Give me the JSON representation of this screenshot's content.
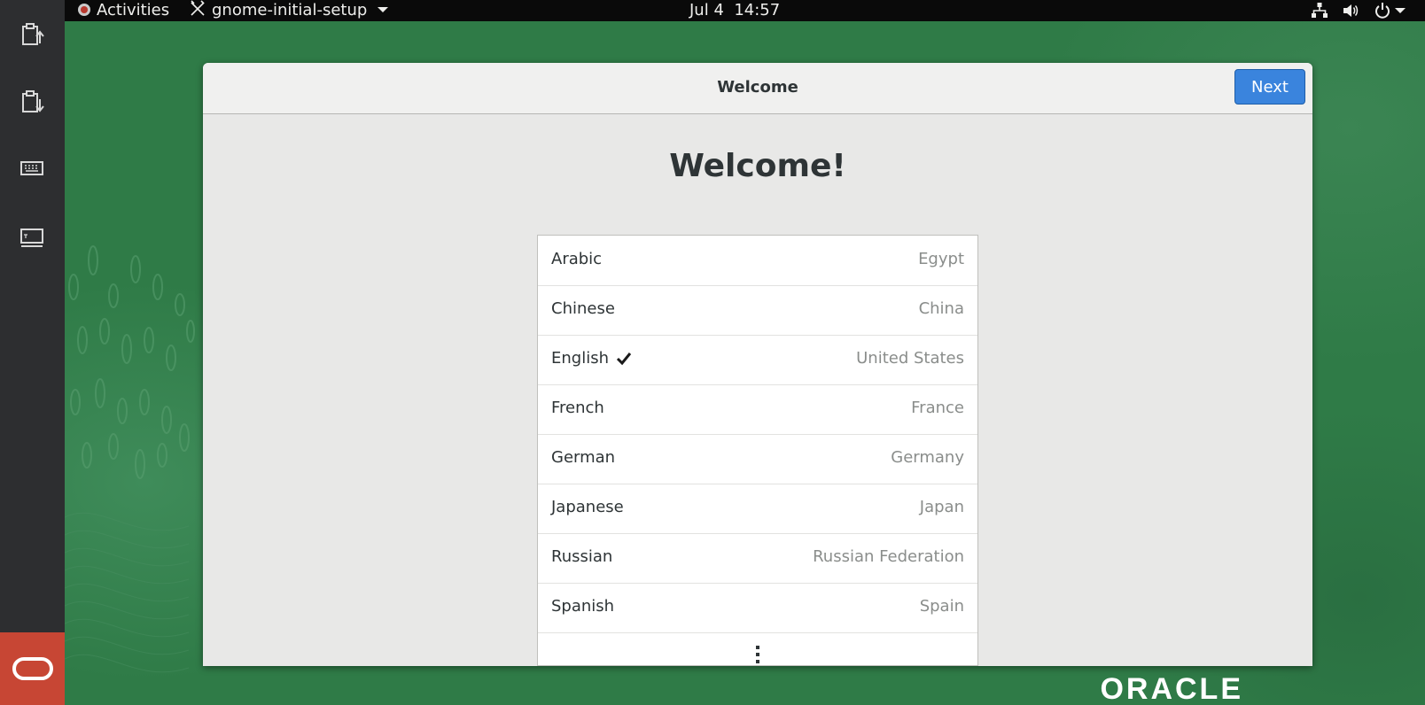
{
  "topbar": {
    "activities": "Activities",
    "app_name": "gnome-initial-setup",
    "clock": "Jul 4  14:57",
    "icons": [
      "network-icon",
      "volume-icon",
      "power-icon"
    ]
  },
  "sidebar": {
    "icons": [
      "clipboard-upload-icon",
      "clipboard-download-icon",
      "keyboard-icon",
      "screen-icon",
      "oracle-logo-icon"
    ],
    "accent_color": "#c74634"
  },
  "window": {
    "title": "Welcome",
    "next_label": "Next",
    "heading": "Welcome!",
    "accent_color": "#3a84dd"
  },
  "languages": [
    {
      "name": "Arabic",
      "region": "Egypt",
      "selected": false
    },
    {
      "name": "Chinese",
      "region": "China",
      "selected": false
    },
    {
      "name": "English",
      "region": "United States",
      "selected": true
    },
    {
      "name": "French",
      "region": "France",
      "selected": false
    },
    {
      "name": "German",
      "region": "Germany",
      "selected": false
    },
    {
      "name": "Japanese",
      "region": "Japan",
      "selected": false
    },
    {
      "name": "Russian",
      "region": "Russian Federation",
      "selected": false
    },
    {
      "name": "Spanish",
      "region": "Spain",
      "selected": false
    }
  ],
  "wallpaper": {
    "brand": "ORACLE"
  }
}
